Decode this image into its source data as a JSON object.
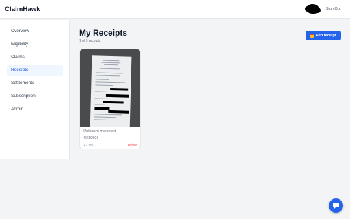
{
  "app": {
    "brand": "ClaimHawk"
  },
  "header": {
    "sign_out_label": "Sign Out"
  },
  "sidebar": {
    "items": [
      {
        "label": "Overview"
      },
      {
        "label": "Eligibility"
      },
      {
        "label": "Claims"
      },
      {
        "label": "Receipts",
        "active": true
      },
      {
        "label": "Settlements"
      },
      {
        "label": "Subscription"
      },
      {
        "label": "Admin"
      }
    ]
  },
  "main": {
    "title": "My Receipts",
    "count_text": "1 of 9 receipts",
    "add_button_label": "Add receipt",
    "add_button_icon": "calendar-icon"
  },
  "receipts": [
    {
      "merchant": "Unknown merchant",
      "date": "4/21/2026",
      "size": "1.1 MB",
      "delete_label": "Delete"
    }
  ],
  "colors": {
    "accent": "#2563eb",
    "danger": "#ef4444",
    "active_nav_bg": "#eff6ff"
  },
  "icons": {
    "chat": "chat-icon",
    "avatar": "avatar"
  }
}
